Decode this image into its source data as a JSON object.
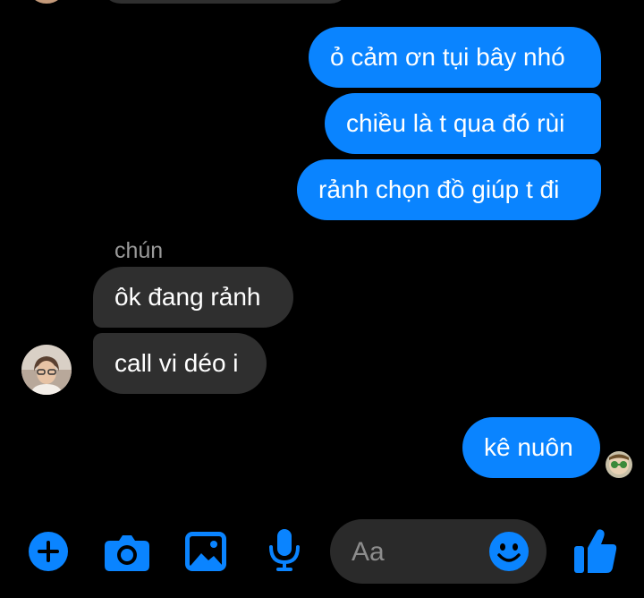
{
  "colors": {
    "accent": "#0a84ff",
    "incoming_bubble": "#2f2f2f",
    "background": "#000000"
  },
  "messages": [
    {
      "direction": "outgoing",
      "text": "ỏ cảm ơn tụi bây nhó"
    },
    {
      "direction": "outgoing",
      "text": "chiều là t qua đó rùi"
    },
    {
      "direction": "outgoing",
      "text": "rảnh chọn đồ giúp t đi"
    },
    {
      "direction": "incoming",
      "sender": "chún",
      "text": "ôk đang rảnh"
    },
    {
      "direction": "incoming",
      "text": "call vi déo i"
    },
    {
      "direction": "outgoing",
      "text": "kê nuôn"
    }
  ],
  "composer": {
    "placeholder": "Aa",
    "buttons": [
      "plus-icon",
      "camera-icon",
      "image-icon",
      "microphone-icon"
    ],
    "emoji_icon": "smile-icon",
    "send_icon": "thumbs-up-icon"
  }
}
